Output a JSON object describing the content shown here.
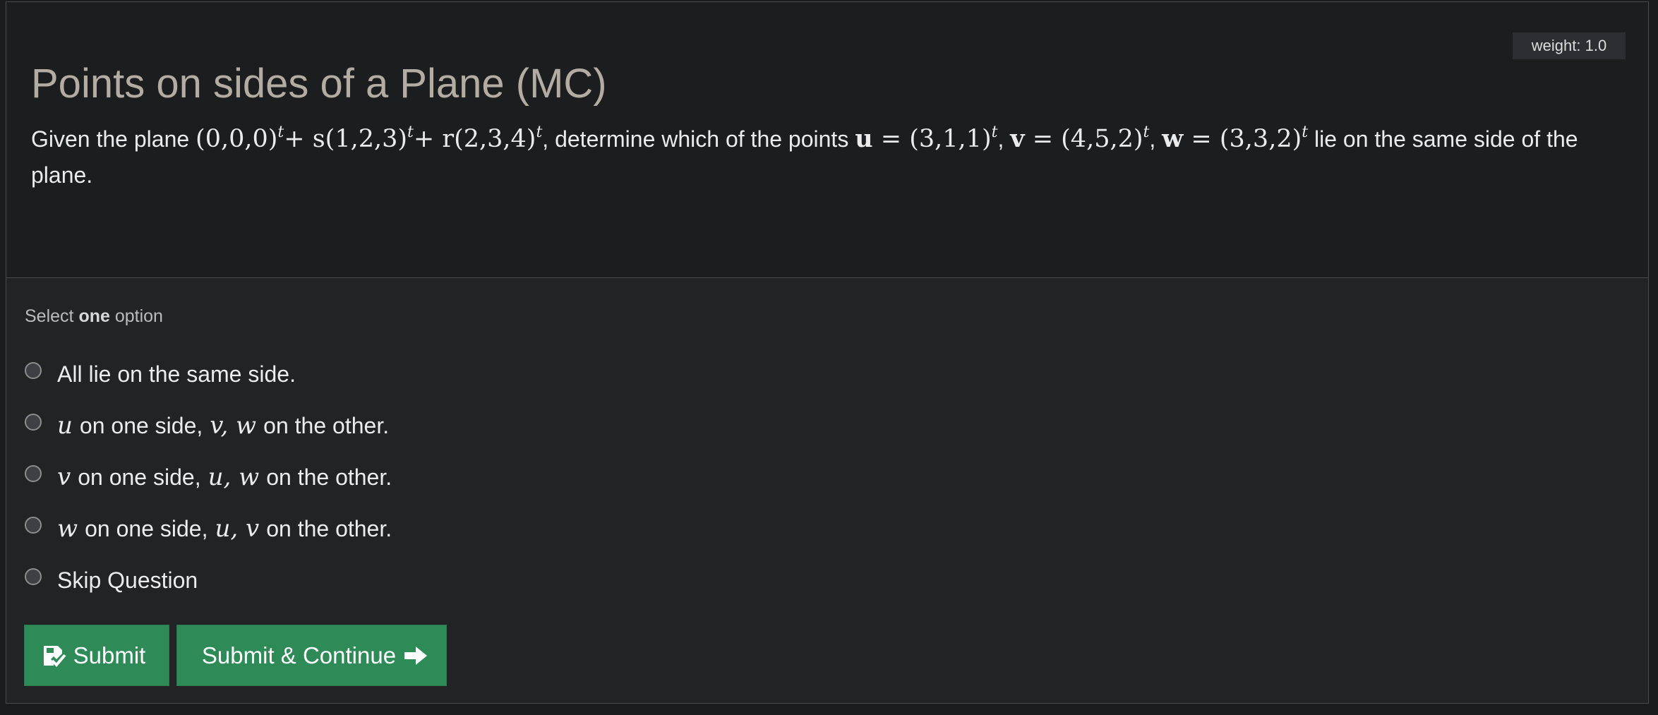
{
  "weight_badge": "weight: 1.0",
  "title": "Points on sides of a Plane (MC)",
  "prompt": {
    "text_before": "Given the plane",
    "plane": [
      "(0,0,0)",
      "t",
      "+ s(1,2,3)",
      "t",
      "+ r(2,3,4)",
      "t"
    ],
    "text_middle": ", determine which of the points",
    "points": [
      {
        "name": "u",
        "value": "(3,1,1)",
        "exp": "t"
      },
      {
        "name": "v",
        "value": "(4,5,2)",
        "exp": "t"
      },
      {
        "name": "w",
        "value": "(3,3,2)",
        "exp": "t"
      }
    ],
    "text_after": "lie on the same side of the plane."
  },
  "select_hint": {
    "before": "Select",
    "emphasis": "one",
    "after": "option"
  },
  "options": [
    {
      "parts": [
        "All lie on the same side."
      ]
    },
    {
      "var1": "u",
      "mid": "on one side,",
      "var2": "v, w",
      "end": "on the other."
    },
    {
      "var1": "v",
      "mid": "on one side,",
      "var2": "u, w",
      "end": "on the other."
    },
    {
      "var1": "w",
      "mid": "on one side,",
      "var2": "u, v",
      "end": "on the other."
    },
    {
      "parts": [
        "Skip Question"
      ]
    }
  ],
  "buttons": {
    "submit": "Submit",
    "submit_continue": "Submit & Continue",
    "submit_icon": "check-square-icon",
    "continue_icon": "arrow-right-icon",
    "color": "#2e8b57"
  }
}
